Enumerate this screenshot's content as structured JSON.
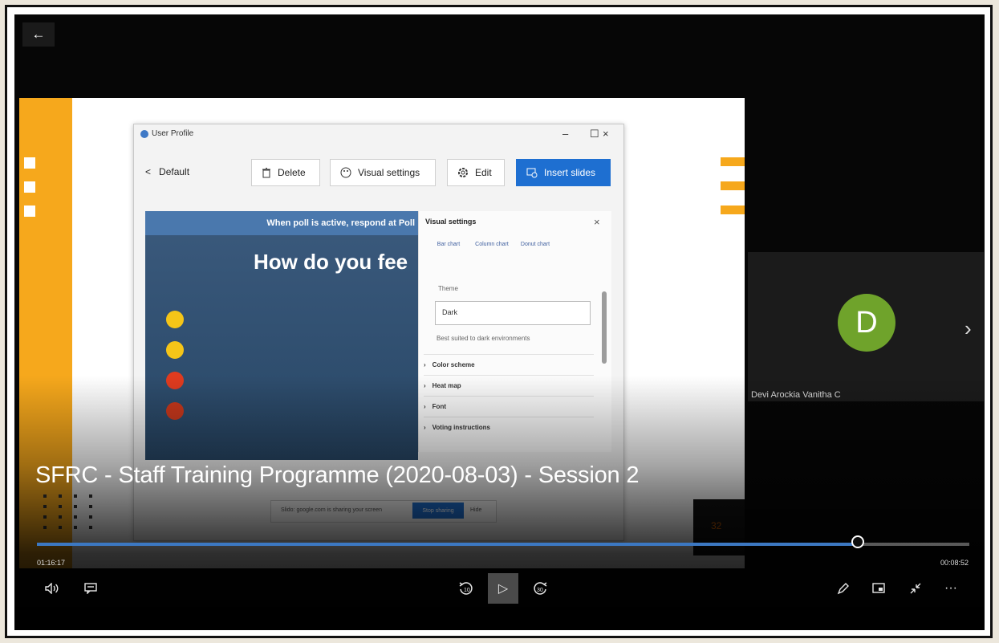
{
  "player": {
    "back_icon": "←",
    "video_title": "SFRC - Staff Training Programme (2020-08-03) - Session 2",
    "progress": 0.88,
    "elapsed_time": "01:16:17",
    "remaining_time": "00:08:52",
    "controls": {
      "volume_icon": "volume-icon",
      "captions_icon": "captions-icon",
      "rewind_icon": "rewind-10-icon",
      "rewind_label": "10",
      "play_icon": "▷",
      "forward_icon": "forward-30-icon",
      "forward_label": "30",
      "pen_icon": "pen-icon",
      "miniview_icon": "mini-view-icon",
      "exit_fullscreen_icon": "exit-fullscreen-icon",
      "more_icon": "···"
    }
  },
  "slide": {
    "window": {
      "title": "User Profile",
      "minimize": "–",
      "maximize": "☐",
      "close": "×",
      "default_label": "Default",
      "back_chevron": "<",
      "delete_label": "Delete",
      "visual_settings_label": "Visual settings",
      "edit_label": "Edit",
      "insert_slides_label": "Insert slides"
    },
    "poll": {
      "banner": "When poll is active, respond at Poll",
      "question": "How do you fee"
    },
    "visual_settings_panel": {
      "title": "Visual settings",
      "close": "×",
      "chart_types": [
        "Bar chart",
        "Column chart",
        "Donut chart"
      ],
      "theme_label": "Theme",
      "theme_value": "Dark",
      "theme_hint": "Best suited to dark environments",
      "rows": [
        "Color scheme",
        "Heat map",
        "Font",
        "Voting instructions"
      ]
    },
    "sharing_bar": {
      "text": "Slido: google.com is sharing your screen",
      "stop_label": "Stop sharing",
      "hide_label": "Hide"
    },
    "page_number": "32"
  },
  "participant": {
    "initial": "D",
    "name": "Devi Arockia Vanitha C",
    "avatar_color": "#6fa32b",
    "next_icon": "›"
  }
}
